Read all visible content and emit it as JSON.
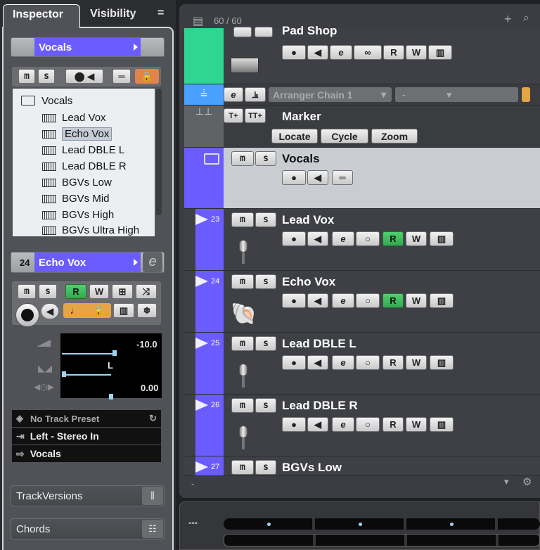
{
  "inspector": {
    "tabs": {
      "inspector": "Inspector",
      "visibility": "Visibility",
      "menu": "="
    },
    "folder_header": {
      "name": "Vocals"
    },
    "tree": {
      "folder": "Vocals",
      "items": [
        "Lead Vox",
        "Echo Vox",
        "Lead DBLE L",
        "Lead DBLE R",
        "BGVs Low",
        "BGVs Mid",
        "BGVs High",
        "BGVs Ultra High"
      ],
      "selected": "Echo Vox"
    },
    "track_header": {
      "number": "24",
      "name": "Echo Vox"
    },
    "buttons": {
      "m": "m",
      "s": "s",
      "r": "R",
      "w": "W",
      "e": "e"
    },
    "volume": "-10.0",
    "pan": "L",
    "delay": "0.00",
    "preset": "No Track Preset",
    "input": "Left - Stereo In",
    "output": "Vocals",
    "sections": [
      "TrackVersions",
      "Chords"
    ]
  },
  "project": {
    "track_count": "60 / 60",
    "top_track_name": "Pad Shop",
    "arranger": {
      "chain": "Arranger Chain 1",
      "value": "-"
    },
    "marker": {
      "name": "Marker",
      "buttons": [
        "Locate",
        "Cycle",
        "Zoom"
      ]
    },
    "folder_track": {
      "name": "Vocals"
    },
    "tracks": [
      {
        "number": "23",
        "name": "Lead Vox",
        "read": true
      },
      {
        "number": "24",
        "name": "Echo Vox",
        "read": true
      },
      {
        "number": "25",
        "name": "Lead DBLE L",
        "read": false
      },
      {
        "number": "26",
        "name": "Lead DBLE R",
        "read": false
      },
      {
        "number": "27",
        "name": "BGVs Low",
        "read": false
      }
    ],
    "footer_minus": "-"
  },
  "mixer": {
    "menu": "---"
  },
  "colors": {
    "accent": "#6b5cff",
    "arranger": "#4aa0ff",
    "instrument": "#2ed68f",
    "read": "#3dbe5e",
    "record_gold": "#e6a545"
  }
}
